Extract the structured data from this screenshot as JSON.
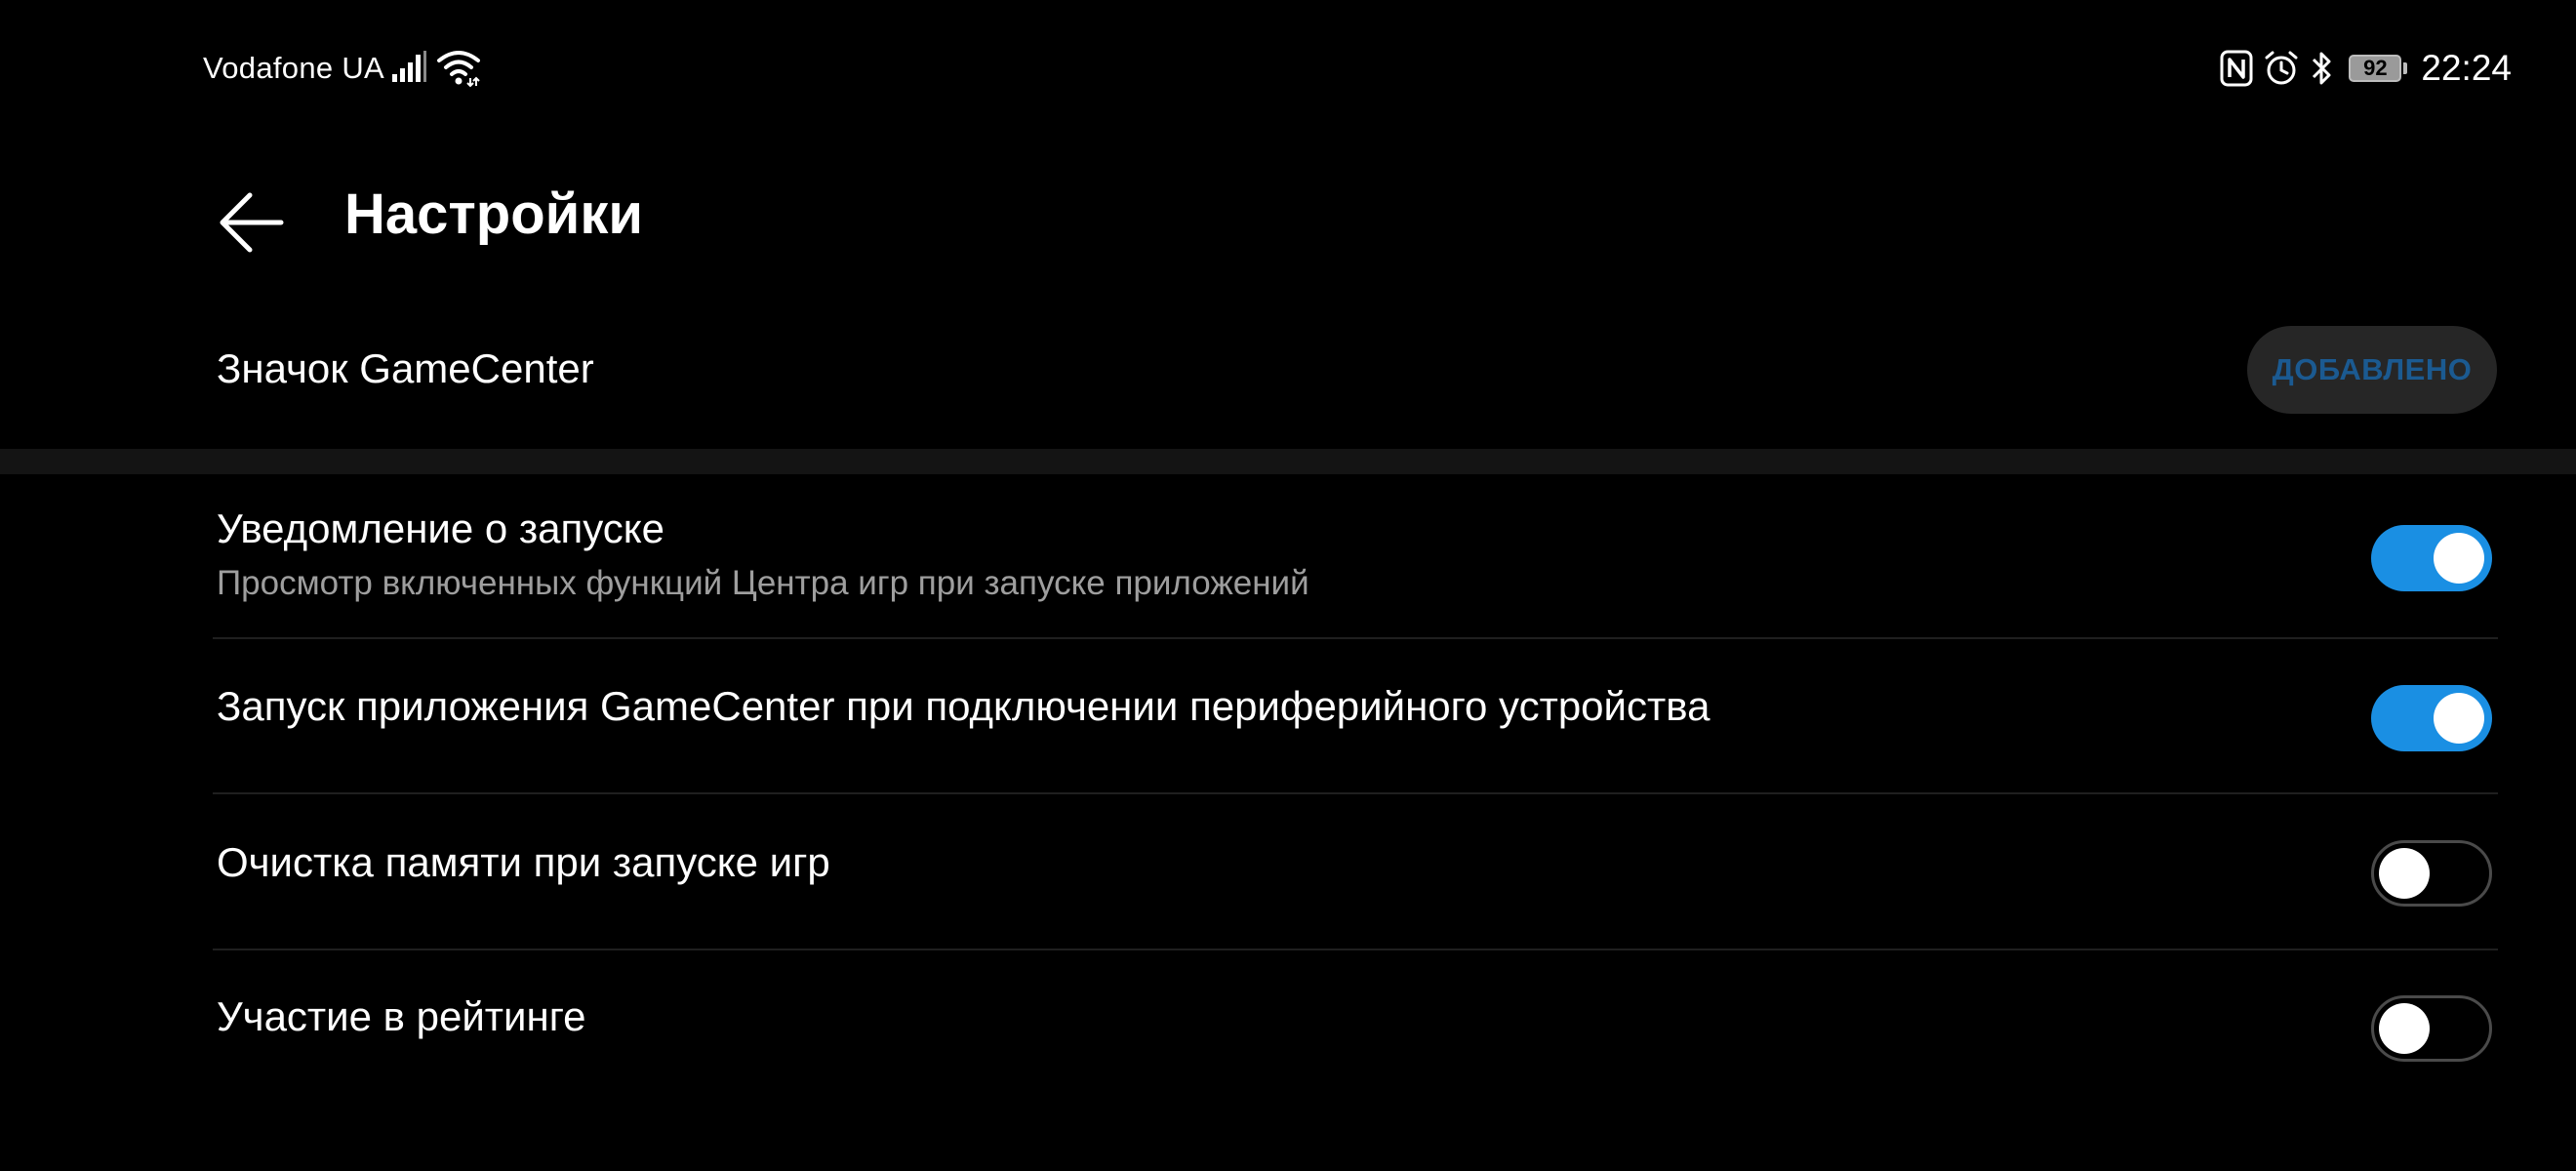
{
  "status_bar": {
    "carrier": "Vodafone UA",
    "icons": [
      "signal-icon",
      "wifi-icon",
      "nfc-icon",
      "alarm-icon",
      "bluetooth-icon",
      "battery-icon"
    ],
    "battery": "92",
    "time": "22:24"
  },
  "header": {
    "back_icon": "arrow-left-icon",
    "title": "Настройки"
  },
  "gamecenter_icon": {
    "label": "Значок GameCenter",
    "button_label": "ДОБАВЛЕНО",
    "button_text_color": "#1b5a91"
  },
  "settings": [
    {
      "title": "Уведомление о запуске",
      "subtitle": "Просмотр включенных функций Центра игр при запуске приложений",
      "enabled": true
    },
    {
      "title": "Запуск приложения GameCenter при подключении периферийного устройства",
      "enabled": true
    },
    {
      "title": "Очистка памяти при запуске игр",
      "enabled": false
    },
    {
      "title": "Участие в рейтинге",
      "enabled": false
    }
  ],
  "colors": {
    "background": "#000000",
    "toggle_on": "#1a8fe3",
    "toggle_off_border": "#4a4a4a",
    "subtitle_text": "#9e9e9e"
  }
}
